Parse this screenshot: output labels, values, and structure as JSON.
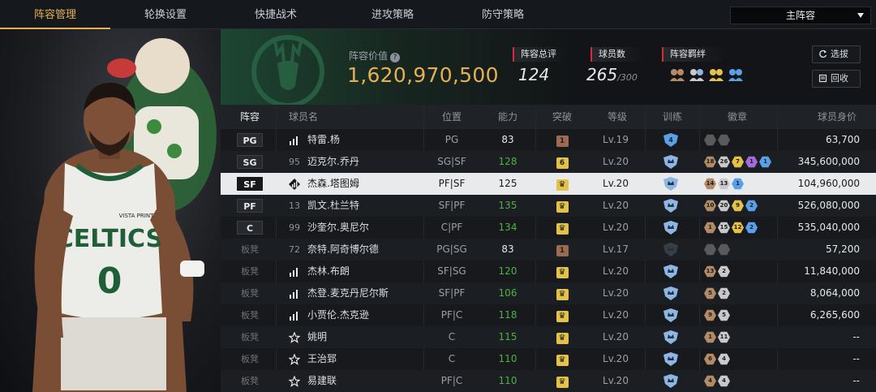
{
  "nav": {
    "tabs": [
      "阵容管理",
      "轮换设置",
      "快捷战术",
      "进攻策略",
      "防守策略"
    ],
    "active_tab": 0,
    "lineup_select": "主阵容"
  },
  "header": {
    "value_label": "阵容价值",
    "value": "1,620,970,500",
    "stats": {
      "overall_label": "阵容总评",
      "overall_value": "124",
      "players_label": "球员数",
      "players_value": "265",
      "players_max": "/300",
      "bonds_label": "阵容羁绊"
    },
    "buttons": {
      "scout": "选拔",
      "recycle": "回收"
    }
  },
  "table": {
    "columns": [
      "阵容",
      "球员名",
      "位置",
      "能力",
      "突破",
      "等级",
      "训练",
      "徽章",
      "球员身价"
    ],
    "rows": [
      {
        "slot": "PG",
        "bench": false,
        "number": "",
        "icon": "bars",
        "name": "特雷.杨",
        "position": "PG",
        "rating": "83",
        "rating_boosted": false,
        "break": "1",
        "break_type": "brown",
        "level": "Lv.19",
        "train": "4",
        "badges": [
          "",
          ""
        ],
        "badge_colors": [
          "#5a5a5c",
          "#5a5a5c"
        ],
        "value": "63,700"
      },
      {
        "slot": "SG",
        "bench": false,
        "number": "95",
        "icon": "",
        "name": "迈克尔.乔丹",
        "position": "SG|SF",
        "rating": "128",
        "rating_boosted": true,
        "break": "6",
        "break_type": "gold",
        "level": "Lv.20",
        "train": "",
        "badges": [
          "18",
          "26",
          "7",
          "1",
          "1"
        ],
        "badge_colors": [
          "#b38a66",
          "#c9c9cc",
          "#e4c24a",
          "#a46ad8",
          "#5aa0e8"
        ],
        "value": "345,600,000"
      },
      {
        "slot": "SF",
        "bench": false,
        "number": "",
        "icon": "diamond",
        "name": "杰森.塔图姆",
        "position": "PF|SF",
        "rating": "125",
        "rating_boosted": false,
        "break": "",
        "break_type": "gold",
        "level": "Lv.20",
        "train": "",
        "badges": [
          "14",
          "13",
          "1"
        ],
        "badge_colors": [
          "#b38a66",
          "#c9c9cc",
          "#5aa0e8"
        ],
        "value": "104,960,000"
      },
      {
        "slot": "PF",
        "bench": false,
        "number": "13",
        "icon": "",
        "name": "凯文.杜兰特",
        "position": "SF|PF",
        "rating": "135",
        "rating_boosted": true,
        "break": "",
        "break_type": "gold",
        "level": "Lv.20",
        "train": "",
        "badges": [
          "10",
          "20",
          "9",
          "2"
        ],
        "badge_colors": [
          "#b38a66",
          "#c9c9cc",
          "#e4c24a",
          "#5aa0e8"
        ],
        "value": "526,080,000"
      },
      {
        "slot": "C",
        "bench": false,
        "number": "99",
        "icon": "",
        "name": "沙奎尔.奥尼尔",
        "position": "C|PF",
        "rating": "134",
        "rating_boosted": true,
        "break": "",
        "break_type": "gold",
        "level": "Lv.20",
        "train": "",
        "badges": [
          "1",
          "15",
          "12",
          "2"
        ],
        "badge_colors": [
          "#b38a66",
          "#c9c9cc",
          "#e4c24a",
          "#5aa0e8"
        ],
        "value": "535,040,000"
      },
      {
        "slot": "板凳",
        "bench": true,
        "number": "72",
        "icon": "",
        "name": "奈特.阿奇博尔德",
        "position": "PG|SG",
        "rating": "83",
        "rating_boosted": false,
        "break": "1",
        "break_type": "brown",
        "level": "Lv.17",
        "train": "",
        "badges": [
          "",
          ""
        ],
        "badge_colors": [
          "#5a5a5c",
          "#5a5a5c"
        ],
        "value": "57,200"
      },
      {
        "slot": "板凳",
        "bench": true,
        "number": "",
        "icon": "bars",
        "name": "杰林.布朗",
        "position": "SF|SG",
        "rating": "120",
        "rating_boosted": true,
        "break": "",
        "break_type": "gold",
        "level": "Lv.20",
        "train": "",
        "badges": [
          "13",
          "2"
        ],
        "badge_colors": [
          "#b38a66",
          "#c9c9cc"
        ],
        "value": "11,840,000"
      },
      {
        "slot": "板凳",
        "bench": true,
        "number": "",
        "icon": "bars",
        "name": "杰登.麦克丹尼尔斯",
        "position": "SF|PF",
        "rating": "106",
        "rating_boosted": true,
        "break": "",
        "break_type": "gold",
        "level": "Lv.20",
        "train": "",
        "badges": [
          "5",
          "2"
        ],
        "badge_colors": [
          "#b38a66",
          "#c9c9cc"
        ],
        "value": "8,064,000"
      },
      {
        "slot": "板凳",
        "bench": true,
        "number": "",
        "icon": "bars",
        "name": "小贾伦.杰克逊",
        "position": "PF|C",
        "rating": "118",
        "rating_boosted": true,
        "break": "",
        "break_type": "gold",
        "level": "Lv.20",
        "train": "",
        "badges": [
          "9",
          "5"
        ],
        "badge_colors": [
          "#b38a66",
          "#c9c9cc"
        ],
        "value": "6,265,600"
      },
      {
        "slot": "板凳",
        "bench": true,
        "number": "",
        "icon": "star",
        "name": "姚明",
        "position": "C",
        "rating": "115",
        "rating_boosted": true,
        "break": "",
        "break_type": "gold",
        "level": "Lv.20",
        "train": "",
        "badges": [
          "1",
          "11"
        ],
        "badge_colors": [
          "#b38a66",
          "#c9c9cc"
        ],
        "value": "--"
      },
      {
        "slot": "板凳",
        "bench": true,
        "number": "",
        "icon": "star",
        "name": "王治郅",
        "position": "C",
        "rating": "110",
        "rating_boosted": true,
        "break": "",
        "break_type": "gold",
        "level": "Lv.20",
        "train": "",
        "badges": [
          "6",
          "4"
        ],
        "badge_colors": [
          "#b38a66",
          "#c9c9cc"
        ],
        "value": "--"
      },
      {
        "slot": "板凳",
        "bench": true,
        "number": "",
        "icon": "star",
        "name": "易建联",
        "position": "PF|C",
        "rating": "110",
        "rating_boosted": true,
        "break": "",
        "break_type": "gold",
        "level": "Lv.20",
        "train": "",
        "badges": [
          "4",
          "4"
        ],
        "badge_colors": [
          "#b38a66",
          "#c9c9cc"
        ],
        "value": "--"
      }
    ],
    "selected_row": 2
  },
  "player_art": {
    "jersey_text": "CELTICS",
    "jersey_number": "0",
    "sponsor": "VISTA PRINT"
  },
  "colors": {
    "accent": "#e4b052",
    "boosted_rating": "#4fb043",
    "stat_marker": "#d02f3a"
  }
}
